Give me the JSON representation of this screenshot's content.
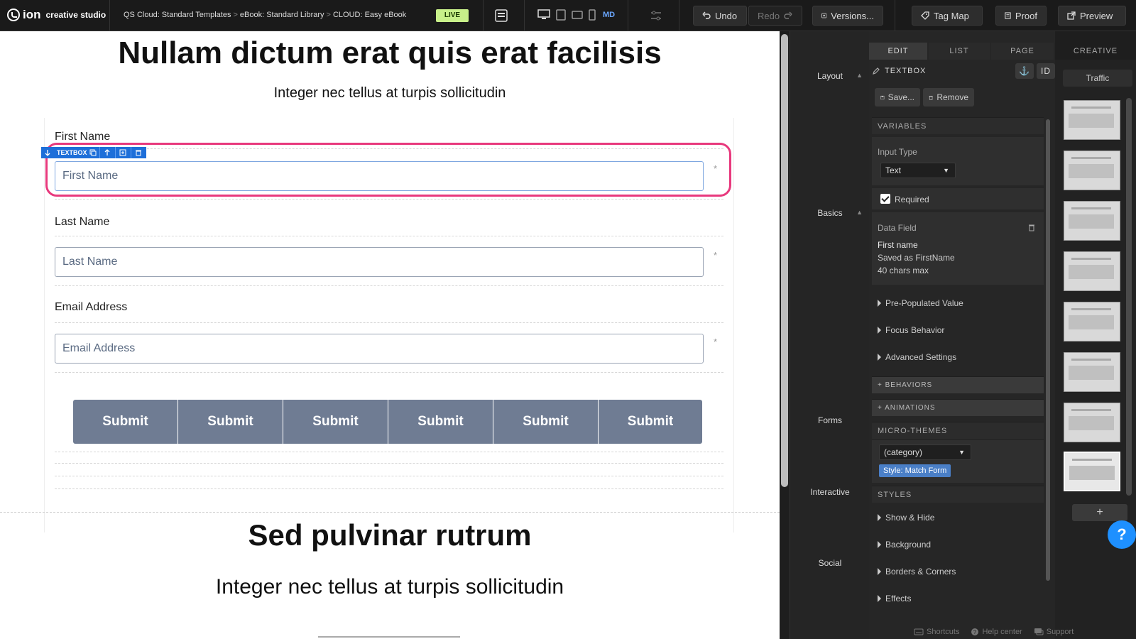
{
  "topbar": {
    "brand": "ion",
    "brand_sub": "creative studio",
    "breadcrumbs": [
      "QS Cloud: Standard Templates",
      "eBook: Standard Library",
      "CLOUD: Easy eBook"
    ],
    "live": "LIVE",
    "device_label": "MD",
    "undo": "Undo",
    "redo": "Redo",
    "versions": "Versions...",
    "tag_map": "Tag Map",
    "proof": "Proof",
    "preview": "Preview"
  },
  "canvas": {
    "heading": "Nullam dictum erat quis erat facilisis",
    "subheading": "Integer nec tellus at turpis sollicitudin",
    "selection_tag": "TEXTBOX",
    "fields": [
      {
        "label": "First Name",
        "placeholder": "First Name"
      },
      {
        "label": "Last Name",
        "placeholder": "Last Name"
      },
      {
        "label": "Email Address",
        "placeholder": "Email Address"
      }
    ],
    "required_mark": "*",
    "submit_buttons": [
      "Submit",
      "Submit",
      "Submit",
      "Submit",
      "Submit",
      "Submit"
    ],
    "section2_heading": "Sed pulvinar rutrum",
    "section2_sub": "Integer nec tellus at turpis sollicitudin"
  },
  "toolbox": {
    "layout": "Layout",
    "basics": "Basics",
    "forms": "Forms",
    "interactive": "Interactive",
    "social": "Social"
  },
  "props": {
    "tabs": [
      "EDIT",
      "LIST",
      "PAGE",
      "CREATIVE"
    ],
    "element_type": "TEXTBOX",
    "id_button": "ID",
    "save": "Save...",
    "remove": "Remove",
    "variables_header": "VARIABLES",
    "input_type_label": "Input Type",
    "input_type_value": "Text",
    "required_label": "Required",
    "data_field_label": "Data Field",
    "data_field_lines": [
      "First name",
      "Saved as FirstName",
      "40 chars max"
    ],
    "expanders": [
      "Pre-Populated Value",
      "Focus Behavior",
      "Advanced Settings"
    ],
    "behaviors": "+ BEHAVIORS",
    "animations": "+ ANIMATIONS",
    "micro_themes_header": "MICRO-THEMES",
    "category_value": "(category)",
    "style_tag": "Style: Match Form",
    "styles_header": "STYLES",
    "style_items": [
      "Show & Hide",
      "Background",
      "Borders & Corners",
      "Effects"
    ]
  },
  "pages": {
    "traffic": "Traffic",
    "add": "+",
    "help": "?"
  },
  "footer": {
    "shortcuts": "Shortcuts",
    "help_center": "Help center",
    "support": "Support"
  }
}
